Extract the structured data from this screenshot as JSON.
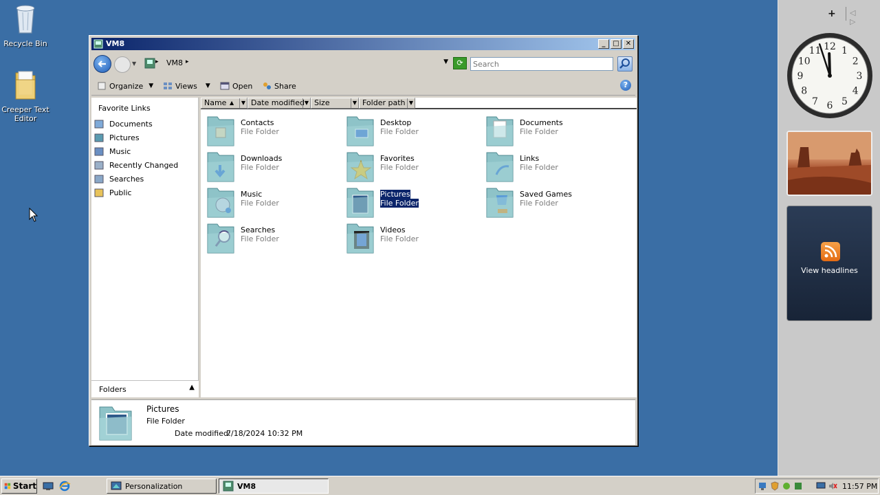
{
  "desktop": {
    "icons": [
      {
        "label": "Recycle Bin",
        "icon": "recycle-bin-icon"
      },
      {
        "label": "Creeper Text Editor",
        "icon": "folder-icon"
      }
    ]
  },
  "sidebar": {
    "add_label": "+",
    "nav_arrows": "◁ ▷",
    "clock": {
      "hour": 11,
      "minute": 57,
      "numerals": [
        "12",
        "1",
        "2",
        "3",
        "4",
        "5",
        "6",
        "7",
        "8",
        "9",
        "10",
        "11"
      ]
    },
    "feed": {
      "label": "View headlines"
    }
  },
  "window": {
    "title": "VM8",
    "address_path": "VM8",
    "search_placeholder": "Search",
    "toolbar": {
      "organize": "Organize",
      "views": "Views",
      "open": "Open",
      "share": "Share",
      "help": "?"
    },
    "nav_pane": {
      "title": "Favorite Links",
      "items": [
        {
          "label": "Documents",
          "icon": "documents-icon"
        },
        {
          "label": "Pictures",
          "icon": "pictures-icon"
        },
        {
          "label": "Music",
          "icon": "music-icon"
        },
        {
          "label": "Recently Changed",
          "icon": "recently-changed-icon"
        },
        {
          "label": "Searches",
          "icon": "searches-icon"
        },
        {
          "label": "Public",
          "icon": "folder-icon"
        }
      ],
      "folders_label": "Folders"
    },
    "columns": [
      "Name",
      "Date modified",
      "Size",
      "Folder path"
    ],
    "files": [
      {
        "name": "Contacts",
        "type": "File Folder",
        "selected": false
      },
      {
        "name": "Desktop",
        "type": "File Folder",
        "selected": false
      },
      {
        "name": "Documents",
        "type": "File Folder",
        "selected": false
      },
      {
        "name": "Downloads",
        "type": "File Folder",
        "selected": false
      },
      {
        "name": "Favorites",
        "type": "File Folder",
        "selected": false
      },
      {
        "name": "Links",
        "type": "File Folder",
        "selected": false
      },
      {
        "name": "Music",
        "type": "File Folder",
        "selected": false
      },
      {
        "name": "Pictures",
        "type": "File Folder",
        "selected": true
      },
      {
        "name": "Saved Games",
        "type": "File Folder",
        "selected": false
      },
      {
        "name": "Searches",
        "type": "File Folder",
        "selected": false
      },
      {
        "name": "Videos",
        "type": "File Folder",
        "selected": false
      }
    ],
    "details": {
      "name": "Pictures",
      "type": "File Folder",
      "date_label": "Date modified:",
      "date_value": "7/18/2024 10:32 PM"
    }
  },
  "taskbar": {
    "start_label": "Start",
    "tasks": [
      {
        "label": "Personalization",
        "active": false
      },
      {
        "label": "VM8",
        "active": true
      }
    ],
    "time": "11:57 PM"
  },
  "colors": {
    "desktop": "#3a6ea5",
    "selection": "#0a246a",
    "title_start": "#0a246a",
    "title_end": "#a6caf0"
  }
}
